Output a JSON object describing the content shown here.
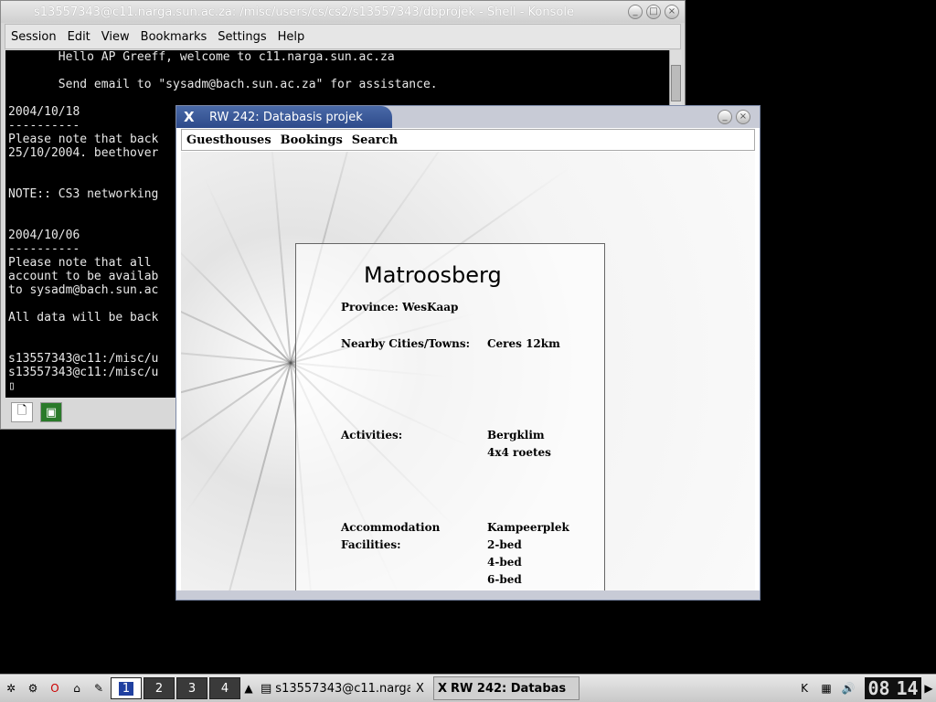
{
  "konsole": {
    "title": "s13557343@c11.narga.sun.ac.za: /misc/users/cs/cs2/s13557343/dbprojek - Shell - Konsole",
    "menu": [
      "Session",
      "Edit",
      "View",
      "Bookmarks",
      "Settings",
      "Help"
    ],
    "lines": [
      "       Hello AP Greeff, welcome to c11.narga.sun.ac.za",
      "",
      "       Send email to \"sysadm@bach.sun.ac.za\" for assistance.",
      "",
      "2004/10/18",
      "----------",
      "Please note that back",
      "25/10/2004. beethover",
      "",
      "",
      "NOTE:: CS3 networking",
      "",
      "",
      "2004/10/06",
      "----------",
      "Please note that all",
      "account to be availab",
      "to sysadm@bach.sun.ac",
      "",
      "All data will be back",
      "",
      "",
      "s13557343@c11:/misc/u",
      "s13557343@c11:/misc/u",
      "▯"
    ]
  },
  "app": {
    "title": "RW 242: Databasis projek",
    "menu": [
      "Guesthouses",
      "Bookings",
      "Search"
    ],
    "guesthouse": {
      "name": "Matroosberg",
      "province_label": "Province:",
      "province": "WesKaap",
      "nearby_label": "Nearby Cities/Towns:",
      "nearby": "Ceres 12km",
      "activities_label": "Activities:",
      "activities": [
        "Bergklim",
        "4x4 roetes"
      ],
      "accommodation_label_1": "Accommodation",
      "accommodation_label_2": "Facilities:",
      "accommodation": [
        "Kampeerplek",
        "2-bed",
        "4-bed",
        "6-bed"
      ]
    }
  },
  "taskbar": {
    "desktops": [
      "1",
      "2",
      "3",
      "4"
    ],
    "tasks": [
      "s13557343@c11.narga",
      "RW 242: Databas"
    ],
    "clock_hours": "08",
    "clock_minutes": "14"
  }
}
